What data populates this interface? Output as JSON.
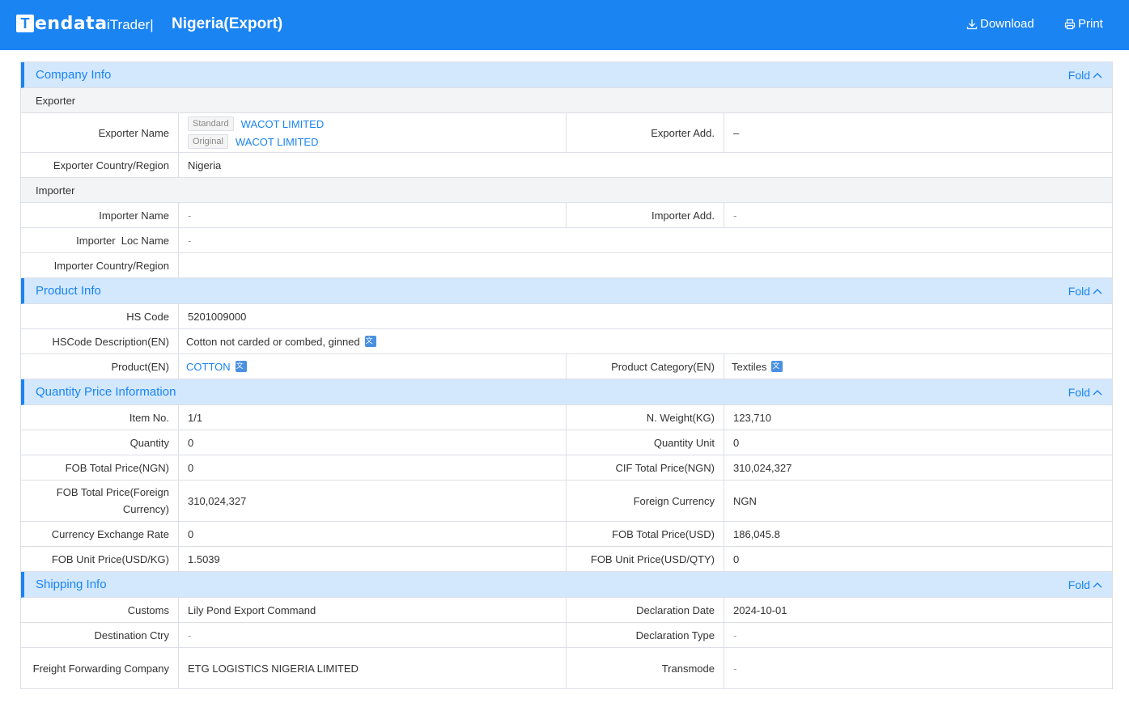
{
  "header": {
    "logo_text": "endata",
    "brand": "iTrader|",
    "title": "Nigeria(Export)",
    "download_label": "Download",
    "print_label": "Print",
    "bg_color": "#1a84f3"
  },
  "fold_label": "Fold",
  "company": {
    "title": "Company Info",
    "exporter_heading": "Exporter",
    "exporter_name_label": "Exporter Name",
    "standard_tag": "Standard",
    "standard_name": "WACOT LIMITED",
    "original_tag": "Original",
    "original_name": "WACOT LIMITED",
    "exporter_add_label": "Exporter Add.",
    "exporter_add_value": "–",
    "exporter_country_label": "Exporter Country/Region",
    "exporter_country_value": "Nigeria",
    "importer_heading": "Importer",
    "importer_name_label": "Importer Name",
    "importer_name_value": "-",
    "importer_add_label": "Importer Add.",
    "importer_add_value": "-",
    "importer_loc_label": "Importer  Loc Name",
    "importer_loc_value": "-",
    "importer_country_label": "Importer Country/Region",
    "importer_country_value": ""
  },
  "product": {
    "title": "Product Info",
    "hs_code_label": "HS Code",
    "hs_code_value": "5201009000",
    "hs_desc_label": "HSCode Description(EN)",
    "hs_desc_value": "Cotton not carded or combed, ginned",
    "product_label": "Product(EN)",
    "product_value": "COTTON",
    "category_label": "Product Category(EN)",
    "category_value": "Textiles"
  },
  "quantity": {
    "title": "Quantity Price Information",
    "rows": [
      {
        "l1": "Item No.",
        "v1": "1/1",
        "l2": "N. Weight(KG)",
        "v2": "123,710"
      },
      {
        "l1": "Quantity",
        "v1": "0",
        "l2": "Quantity Unit",
        "v2": "0"
      },
      {
        "l1": "FOB Total Price(NGN)",
        "v1": "0",
        "l2": "CIF Total Price(NGN)",
        "v2": "310,024,327"
      },
      {
        "l1": "FOB Total Price(Foreign Currency)",
        "v1": "310,024,327",
        "l2": "Foreign Currency",
        "v2": "NGN"
      },
      {
        "l1": "Currency Exchange Rate",
        "v1": "0",
        "l2": "FOB Total Price(USD)",
        "v2": "186,045.8"
      },
      {
        "l1": "FOB Unit Price(USD/KG)",
        "v1": "1.5039",
        "l2": "FOB Unit Price(USD/QTY)",
        "v2": "0"
      }
    ]
  },
  "shipping": {
    "title": "Shipping Info",
    "rows": [
      {
        "l1": "Customs",
        "v1": "Lily Pond Export Command",
        "l2": "Declaration Date",
        "v2": "2024-10-01"
      },
      {
        "l1": "Destination Ctry",
        "v1": "-",
        "l2": "Declaration Type",
        "v2": "-"
      },
      {
        "l1": "Freight Forwarding Company",
        "v1": "ETG LOGISTICS NIGERIA LIMITED",
        "l2": "Transmode",
        "v2": "-"
      }
    ]
  }
}
